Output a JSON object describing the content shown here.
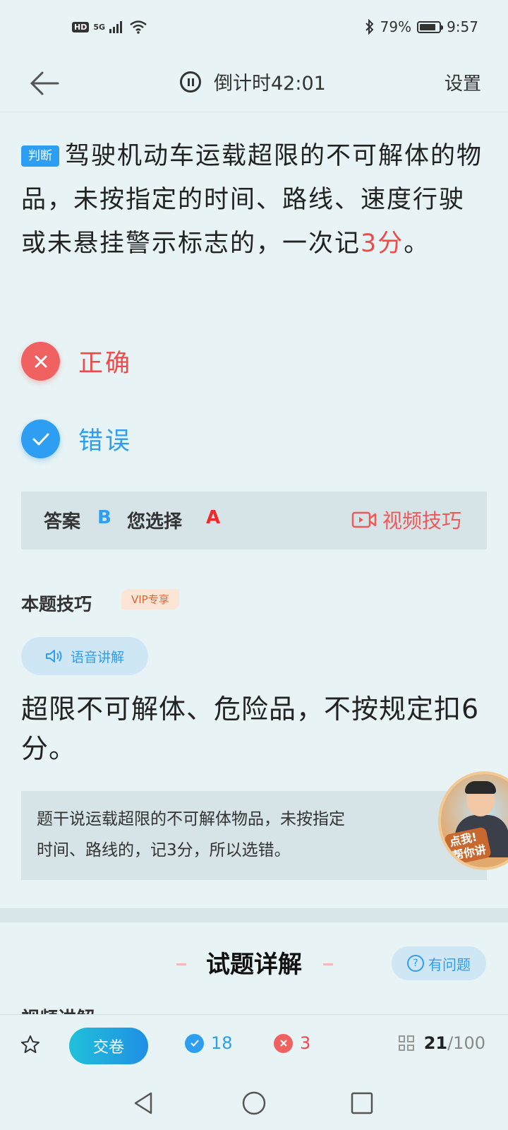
{
  "status_bar": {
    "hd": "HD",
    "network": "5G",
    "battery": "79%",
    "time": "9:57"
  },
  "header": {
    "timer": "倒计时42:01",
    "settings": "设置"
  },
  "question": {
    "type_tag": "判断",
    "text_before": "驾驶机动车运载超限的不可解体的物品，未按指定的时间、路线、速度行驶或未悬挂警示标志的，一次记",
    "text_highlight": "3分",
    "text_after": "。"
  },
  "options": [
    {
      "label": "正确",
      "state": "wrong-selected"
    },
    {
      "label": "错误",
      "state": "correct"
    }
  ],
  "answer_bar": {
    "answer_label": "答案",
    "answer_value": "B",
    "chosen_label": "您选择",
    "chosen_value": "A",
    "video_label": "视频技巧"
  },
  "tips": {
    "title": "本题技巧",
    "vip_badge": "VIP专享",
    "voice_label": "语音讲解",
    "main": "超限不可解体、危险品，不按规定扣6分。",
    "detail_line1": "题干说运载超限的不可解体物品，未按指定",
    "detail_line2": "时间、路线的，记3分，所以选错。",
    "avatar_text_1": "点我!",
    "avatar_text_2": "帮你讲"
  },
  "detail": {
    "title": "试题详解",
    "ask_label": "有问题",
    "partial_heading": "视频讲解"
  },
  "bottom_bar": {
    "submit_label": "交卷",
    "correct_count": "18",
    "wrong_count": "3",
    "current": "21",
    "total": "/100"
  },
  "colors": {
    "accent": "#2e9ef2",
    "error": "#ee4a4a",
    "background": "#e8f3f5"
  }
}
